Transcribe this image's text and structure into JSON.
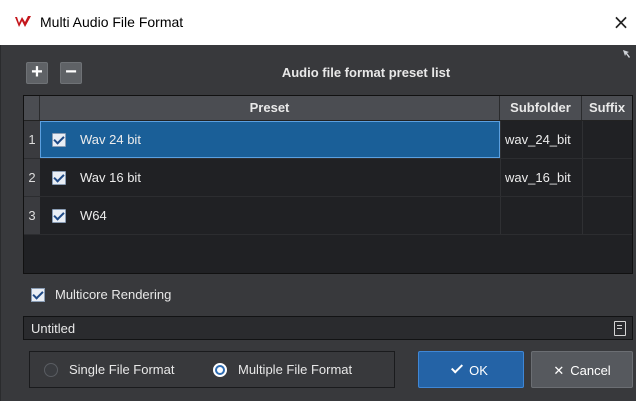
{
  "window": {
    "title": "Multi Audio File Format",
    "close_glyph": "×"
  },
  "toolbar": {
    "add_glyph": "+",
    "remove_glyph": "−",
    "list_title": "Audio file format preset list"
  },
  "table": {
    "columns": [
      "Preset",
      "Subfolder",
      "Suffix"
    ],
    "rows": [
      {
        "index": "1",
        "checked": true,
        "preset": "Wav 24 bit",
        "subfolder": "wav_24_bit",
        "suffix": "",
        "selected": true
      },
      {
        "index": "2",
        "checked": true,
        "preset": "Wav 16 bit",
        "subfolder": "wav_16_bit",
        "suffix": "",
        "selected": false
      },
      {
        "index": "3",
        "checked": true,
        "preset": "W64",
        "subfolder": "",
        "suffix": "",
        "selected": false
      }
    ]
  },
  "multicore": {
    "label": "Multicore Rendering",
    "checked": true
  },
  "preset_name": {
    "value": "Untitled"
  },
  "format_mode": {
    "options": [
      "Single File Format",
      "Multiple File Format"
    ],
    "selected": "Multiple File Format"
  },
  "buttons": {
    "ok": "OK",
    "cancel": "Cancel"
  },
  "colors": {
    "dialog_bg": "#38393c",
    "accent": "#2463a6",
    "selection": "#1a5f98"
  }
}
